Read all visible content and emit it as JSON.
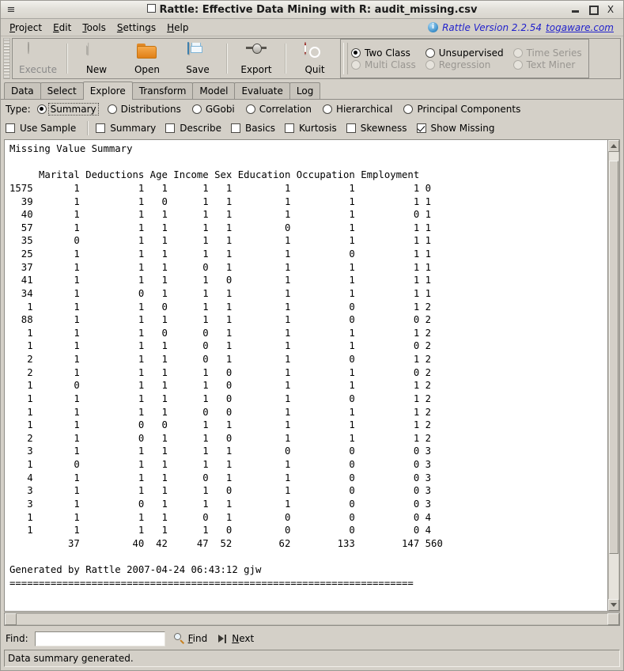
{
  "window": {
    "title": "Rattle: Effective Data Mining with R: audit_missing.csv",
    "menu_glyph": "≡",
    "minimize": "minimize-button",
    "maximize": "maximize-button",
    "close_label": "X"
  },
  "menubar": {
    "items": [
      {
        "label": "Project",
        "mnemonic": "P"
      },
      {
        "label": "Edit",
        "mnemonic": "E"
      },
      {
        "label": "Tools",
        "mnemonic": "T"
      },
      {
        "label": "Settings",
        "mnemonic": "S"
      },
      {
        "label": "Help",
        "mnemonic": "H"
      }
    ],
    "version_text": "Rattle Version 2.2.54",
    "link_text": "togaware.com",
    "info_icon": "info-icon",
    "link_color": "#2222cc"
  },
  "toolbar": {
    "buttons": [
      {
        "label": "Execute",
        "icon": "execute-icon",
        "enabled": false
      },
      {
        "label": "New",
        "icon": "new-document-icon",
        "enabled": true
      },
      {
        "label": "Open",
        "icon": "open-folder-icon",
        "enabled": true
      },
      {
        "label": "Save",
        "icon": "save-disk-icon",
        "enabled": true
      },
      {
        "label": "Export",
        "icon": "export-icon",
        "enabled": true
      },
      {
        "label": "Quit",
        "icon": "power-quit-icon",
        "enabled": true
      }
    ]
  },
  "mode_radios": [
    {
      "label": "Two Class",
      "selected": true,
      "enabled": true
    },
    {
      "label": "Unsupervised",
      "selected": false,
      "enabled": true
    },
    {
      "label": "Time Series",
      "selected": false,
      "enabled": false
    },
    {
      "label": "Multi Class",
      "selected": false,
      "enabled": false
    },
    {
      "label": "Regression",
      "selected": false,
      "enabled": false
    },
    {
      "label": "Text Miner",
      "selected": false,
      "enabled": false
    }
  ],
  "tabs": [
    {
      "label": "Data",
      "active": false
    },
    {
      "label": "Select",
      "active": false
    },
    {
      "label": "Explore",
      "active": true
    },
    {
      "label": "Transform",
      "active": false
    },
    {
      "label": "Model",
      "active": false
    },
    {
      "label": "Evaluate",
      "active": false
    },
    {
      "label": "Log",
      "active": false
    }
  ],
  "type_row": {
    "label": "Type:",
    "options": [
      {
        "label": "Summary",
        "selected": true,
        "focused": true
      },
      {
        "label": "Distributions",
        "selected": false,
        "focused": false
      },
      {
        "label": "GGobi",
        "selected": false,
        "focused": false
      },
      {
        "label": "Correlation",
        "selected": false,
        "focused": false
      },
      {
        "label": "Hierarchical",
        "selected": false,
        "focused": false
      },
      {
        "label": "Principal Components",
        "selected": false,
        "focused": false
      }
    ]
  },
  "check_row": [
    {
      "label": "Use Sample",
      "checked": false
    },
    {
      "label": "Summary",
      "checked": false
    },
    {
      "label": "Describe",
      "checked": false
    },
    {
      "label": "Basics",
      "checked": false
    },
    {
      "label": "Kurtosis",
      "checked": false
    },
    {
      "label": "Skewness",
      "checked": false
    },
    {
      "label": "Show Missing",
      "checked": true
    }
  ],
  "textview": {
    "content": "Missing Value Summary\n\n     Marital Deductions Age Income Sex Education Occupation Employment\n1575       1          1   1      1   1         1          1          1 0\n  39       1          1   0      1   1         1          1          1 1\n  40       1          1   1      1   1         1          1          0 1\n  57       1          1   1      1   1         0          1          1 1\n  35       0          1   1      1   1         1          1          1 1\n  25       1          1   1      1   1         1          0          1 1\n  37       1          1   1      0   1         1          1          1 1\n  41       1          1   1      1   0         1          1          1 1\n  34       1          0   1      1   1         1          1          1 1\n   1       1          1   0      1   1         1          0          1 2\n  88       1          1   1      1   1         1          0          0 2\n   1       1          1   0      0   1         1          1          1 2\n   1       1          1   1      0   1         1          1          0 2\n   2       1          1   1      0   1         1          0          1 2\n   2       1          1   1      1   0         1          1          0 2\n   1       0          1   1      1   0         1          1          1 2\n   1       1          1   1      1   0         1          0          1 2\n   1       1          1   1      0   0         1          1          1 2\n   1       1          0   0      1   1         1          1          1 2\n   2       1          0   1      1   0         1          1          1 2\n   3       1          1   1      1   1         0          0          0 3\n   1       0          1   1      1   1         1          0          0 3\n   4       1          1   1      0   1         1          0          0 3\n   3       1          1   1      1   0         1          0          0 3\n   3       1          0   1      1   1         1          0          0 3\n   1       1          1   1      0   1         0          0          0 4\n   1       1          1   1      1   0         0          0          0 4\n          37         40  42     47  52        62        133        147 560\n\nGenerated by Rattle 2007-04-24 06:43:12 gjw\n=====================================================================",
    "title_line": "Missing Value Summary",
    "columns": [
      "",
      "Marital",
      "Deductions",
      "Age",
      "Income",
      "Sex",
      "Education",
      "Occupation",
      "Employment",
      ""
    ],
    "totals": [
      "",
      "37",
      "40",
      "42",
      "47",
      "52",
      "62",
      "133",
      "147",
      "560"
    ],
    "footer": "Generated by Rattle 2007-04-24 06:43:12 gjw",
    "timestamp": "2007-04-24 06:43:12",
    "user": "gjw"
  },
  "scrollbars": {
    "vertical": {
      "thumb_top_pct": 2,
      "thumb_height_pct": 88
    },
    "horizontal": {
      "thumb_visible": false
    }
  },
  "findbar": {
    "label": "Find:",
    "value": "",
    "placeholder": "",
    "find_label": "Find",
    "find_mnemonic": "F",
    "next_label": "Next",
    "next_mnemonic": "N",
    "find_icon": "magnifier-icon",
    "next_icon": "next-arrow-icon"
  },
  "statusbar": {
    "message": "Data summary generated."
  }
}
